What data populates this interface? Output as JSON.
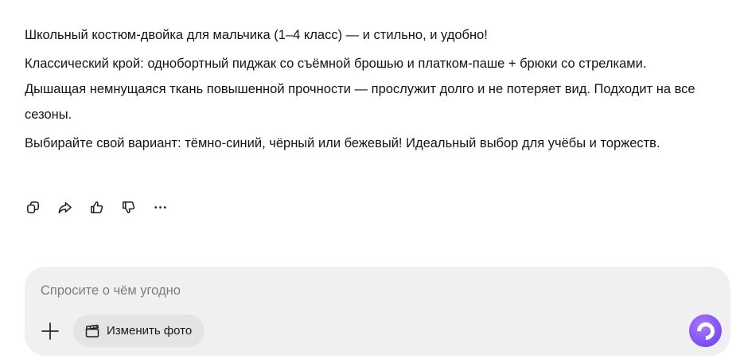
{
  "message": {
    "paragraphs": [
      "Школьный костюм-двойка для мальчика (1–4 класс) — и стильно, и удобно!",
      "Классический крой: однобортный пиджак со съёмной брошью и платком-паше + брюки со стрелками. Дышащая немнущаяся ткань повышенной прочности — прослужит долго и не потеряет вид. Подходит на все сезоны.",
      "Выбирайте свой вариант: тёмно-синий, чёрный или бежевый! Идеальный выбор для учёбы и торжеств."
    ]
  },
  "actions": {
    "icons": [
      "copy-icon",
      "share-icon",
      "thumbs-up-icon",
      "thumbs-down-icon",
      "more-icon"
    ]
  },
  "composer": {
    "placeholder": "Спросите о чём угодно",
    "value": "",
    "chip_label": "Изменить фото",
    "accent_color": "#8a5cf6"
  }
}
